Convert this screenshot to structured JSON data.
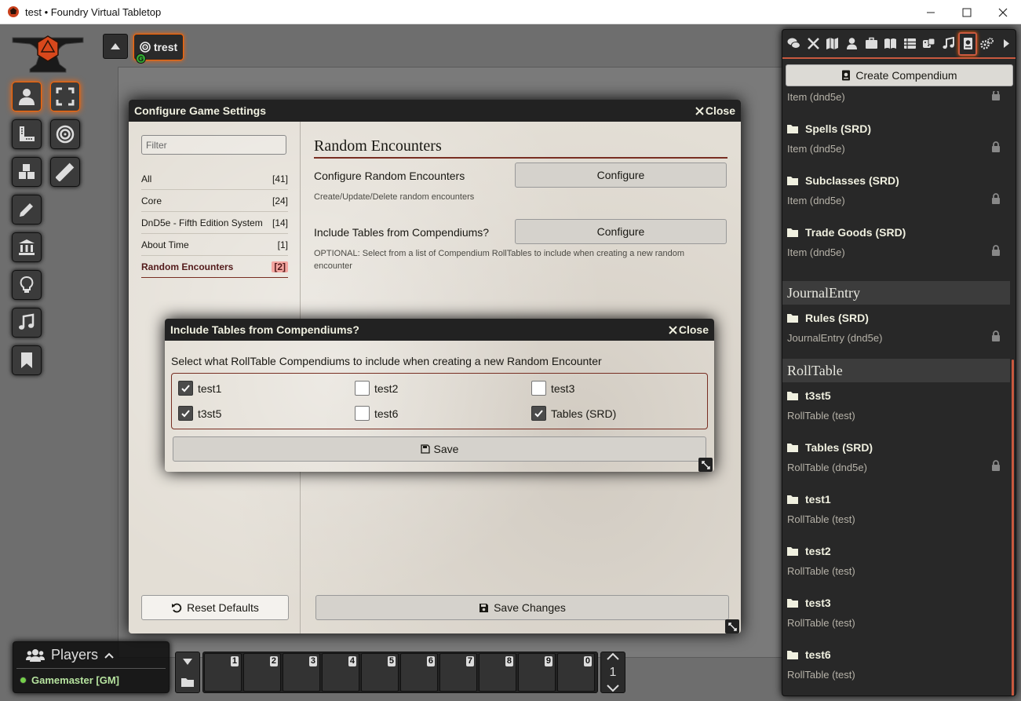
{
  "window": {
    "title": "test • Foundry Virtual Tabletop"
  },
  "navigation": {
    "scene_name": "trest",
    "gm_badge": "G"
  },
  "settings_window": {
    "title": "Configure Game Settings",
    "close_label": "Close",
    "filter_placeholder": "Filter",
    "categories": [
      {
        "label": "All",
        "count": "[41]"
      },
      {
        "label": "Core",
        "count": "[24]"
      },
      {
        "label": "DnD5e - Fifth Edition System",
        "count": "[14]"
      },
      {
        "label": "About Time",
        "count": "[1]"
      },
      {
        "label": "Random Encounters",
        "count": "[2]"
      }
    ],
    "active_category": "Random Encounters",
    "section_title": "Random Encounters",
    "settings": [
      {
        "label": "Configure Random Encounters",
        "button": "Configure",
        "hint": "Create/Update/Delete random encounters"
      },
      {
        "label": "Include Tables from Compendiums?",
        "button": "Configure",
        "hint": "OPTIONAL: Select from a list of Compendium RollTables to include when creating a new random encounter"
      }
    ],
    "reset_label": "Reset Defaults",
    "save_label": "Save Changes"
  },
  "tables_window": {
    "title": "Include Tables from Compendiums?",
    "close_label": "Close",
    "description": "Select what RollTable Compendiums to include when creating a new Random Encounter",
    "options": [
      {
        "label": "test1",
        "checked": true
      },
      {
        "label": "test2",
        "checked": false
      },
      {
        "label": "test3",
        "checked": false
      },
      {
        "label": "t3st5",
        "checked": true
      },
      {
        "label": "test6",
        "checked": false
      },
      {
        "label": "Tables (SRD)",
        "checked": true
      }
    ],
    "save_label": "Save"
  },
  "players": {
    "title": "Players",
    "list": [
      {
        "name": "Gamemaster [GM]"
      }
    ]
  },
  "hotbar": {
    "slots": [
      "1",
      "2",
      "3",
      "4",
      "5",
      "6",
      "7",
      "8",
      "9",
      "0"
    ],
    "page": "1"
  },
  "sidebar": {
    "create_label": "Create Compendium",
    "partial_entry": {
      "type": "Item (dnd5e)"
    },
    "packs_items": [
      {
        "name": "Spells (SRD)",
        "type": "Item (dnd5e)",
        "locked": true
      },
      {
        "name": "Subclasses (SRD)",
        "type": "Item (dnd5e)",
        "locked": true
      },
      {
        "name": "Trade Goods (SRD)",
        "type": "Item (dnd5e)",
        "locked": true
      }
    ],
    "header_journal": "JournalEntry",
    "packs_journal": [
      {
        "name": "Rules (SRD)",
        "type": "JournalEntry (dnd5e)",
        "locked": true
      }
    ],
    "header_rolltable": "RollTable",
    "packs_rolltable": [
      {
        "name": "t3st5",
        "type": "RollTable (test)",
        "locked": false
      },
      {
        "name": "Tables (SRD)",
        "type": "RollTable (dnd5e)",
        "locked": true
      },
      {
        "name": "test1",
        "type": "RollTable (test)",
        "locked": false
      },
      {
        "name": "test2",
        "type": "RollTable (test)",
        "locked": false
      },
      {
        "name": "test3",
        "type": "RollTable (test)",
        "locked": false
      },
      {
        "name": "test6",
        "type": "RollTable (test)",
        "locked": false
      }
    ]
  },
  "colors": {
    "accent": "#ff6400",
    "header_red": "#782e22",
    "parchment": "#e3ded5"
  }
}
